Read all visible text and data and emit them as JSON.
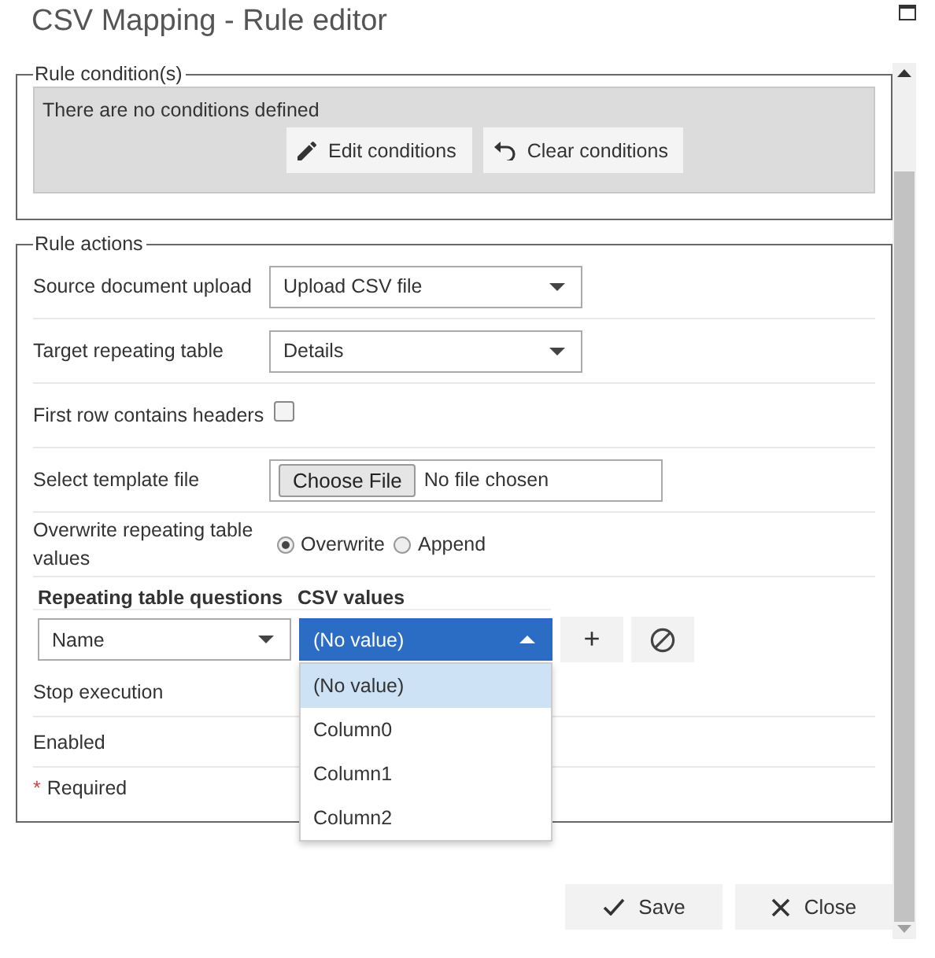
{
  "window": {
    "title": "CSV Mapping - Rule editor"
  },
  "conditions": {
    "legend": "Rule condition(s)",
    "message": "There are no conditions defined",
    "buttons": [
      {
        "label": "Edit conditions",
        "kind": "pencil"
      },
      {
        "label": "Clear conditions",
        "kind": "undo"
      }
    ]
  },
  "actions": {
    "legend": "Rule actions",
    "fields": [
      {
        "kind": "select",
        "label": "Source document upload",
        "value": "Upload CSV file"
      },
      {
        "kind": "select",
        "label": "Target repeating table",
        "value": "Details"
      },
      {
        "kind": "checkbox",
        "label": "First row contains headers",
        "checked": false
      },
      {
        "kind": "file",
        "label": "Select template file",
        "button": "Choose File",
        "value": "No file chosen"
      },
      {
        "kind": "radio",
        "label": "Overwrite repeating table values",
        "options": [
          {
            "label": "Overwrite",
            "selected": true
          },
          {
            "label": "Append",
            "selected": false
          }
        ]
      }
    ],
    "mapping": {
      "columns": [
        "Repeating table questions",
        "CSV values"
      ],
      "rows": [
        {
          "question": "Name",
          "csv": "(No value)",
          "expanded": true,
          "add": "+",
          "options": [
            {
              "label": "(No value)",
              "selected": true
            },
            {
              "label": "Column0",
              "selected": false
            },
            {
              "label": "Column1",
              "selected": false
            },
            {
              "label": "Column2",
              "selected": false
            }
          ]
        }
      ]
    },
    "flags": [
      {
        "label": "Stop execution"
      },
      {
        "label": "Enabled"
      }
    ],
    "required": {
      "mark": "*",
      "label": "Required"
    }
  },
  "buttons": [
    {
      "label": "Save",
      "kind": "check"
    },
    {
      "label": "Close",
      "kind": "close"
    }
  ]
}
